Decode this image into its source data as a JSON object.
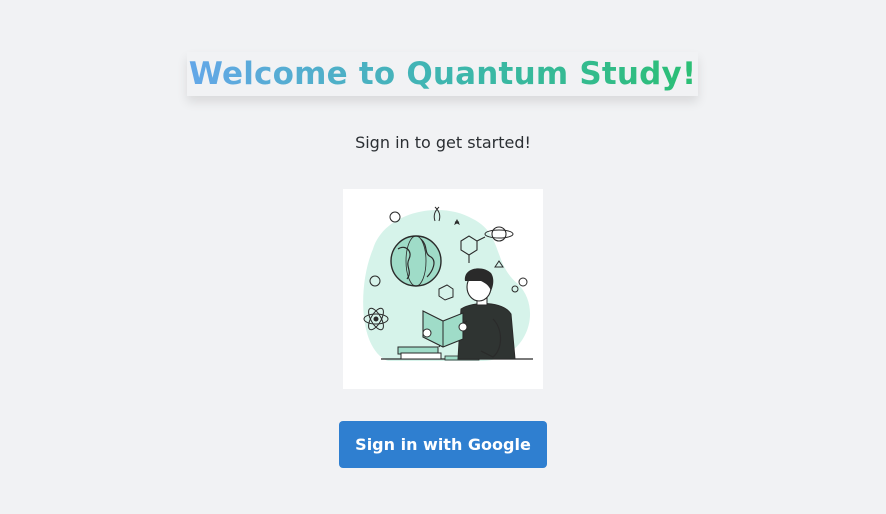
{
  "header": {
    "title": "Welcome to Quantum Study!"
  },
  "main": {
    "subtitle": "Sign in to get started!",
    "illustration_icon": "student-reading-science-illustration",
    "sign_in_button": "Sign in with Google"
  },
  "colors": {
    "background": "#f1f2f4",
    "title_gradient_start": "#64a7e8",
    "title_gradient_end": "#2bbf74",
    "button": "#2f7fd0",
    "illustration_accent": "#c9efe3"
  }
}
